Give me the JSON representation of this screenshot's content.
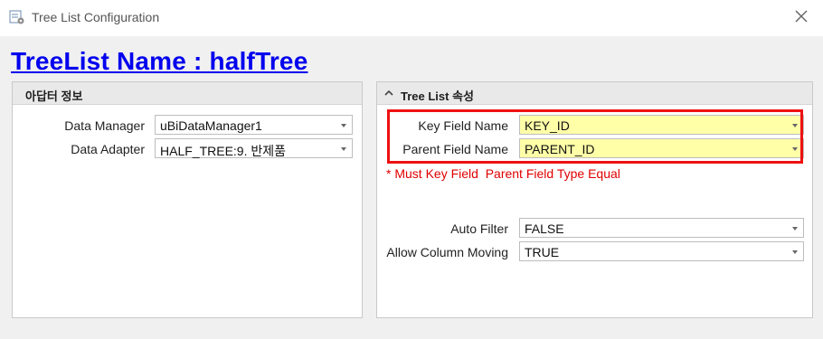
{
  "window": {
    "title": "Tree List Configuration",
    "close_icon": "close-icon"
  },
  "page_title": "TreeList Name : halfTree",
  "adapter_panel": {
    "header": "아답터 정보",
    "data_manager": {
      "label": "Data Manager",
      "value": "uBiDataManager1"
    },
    "data_adapter": {
      "label": "Data Adapter",
      "value": "HALF_TREE:9. 반제품"
    }
  },
  "treelist_panel": {
    "header": "Tree List 속성",
    "collapse_icon": "chevron-up-icon",
    "key_field": {
      "label": "Key Field Name",
      "value": "KEY_ID"
    },
    "parent_field": {
      "label": "Parent Field Name",
      "value": "PARENT_ID"
    },
    "note": "* Must Key Field  Parent Field Type Equal",
    "auto_filter": {
      "label": "Auto Filter",
      "value": "FALSE"
    },
    "allow_column_moving": {
      "label": "Allow Column Moving",
      "value": "TRUE"
    }
  },
  "colors": {
    "highlight_field": "#ffffa8",
    "red_outline": "#ee1111",
    "note_text": "#e00000",
    "title_link": "#0000ee"
  }
}
